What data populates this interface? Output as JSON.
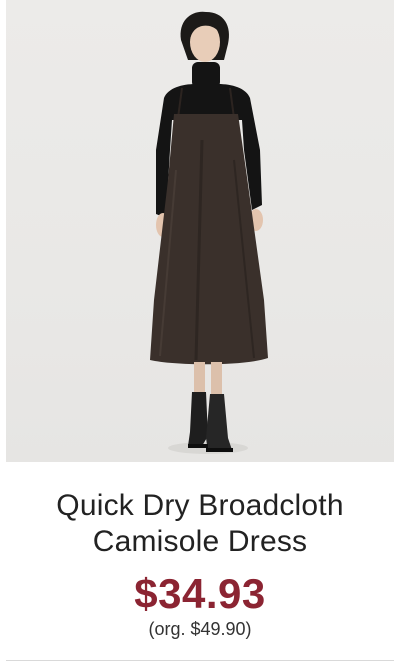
{
  "product": {
    "image_alt": "Model wearing a dark brown camisole dress over a black turtleneck with black boots",
    "title_line1": "Quick Dry Broadcloth",
    "title_line2": "Camisole Dress",
    "sale_price": "$34.93",
    "original_price": "(org. $49.90)"
  },
  "colors": {
    "sale_price": "#8b2432",
    "dress": "#3a302b",
    "turtleneck": "#141414",
    "background": "#ebeae8"
  }
}
